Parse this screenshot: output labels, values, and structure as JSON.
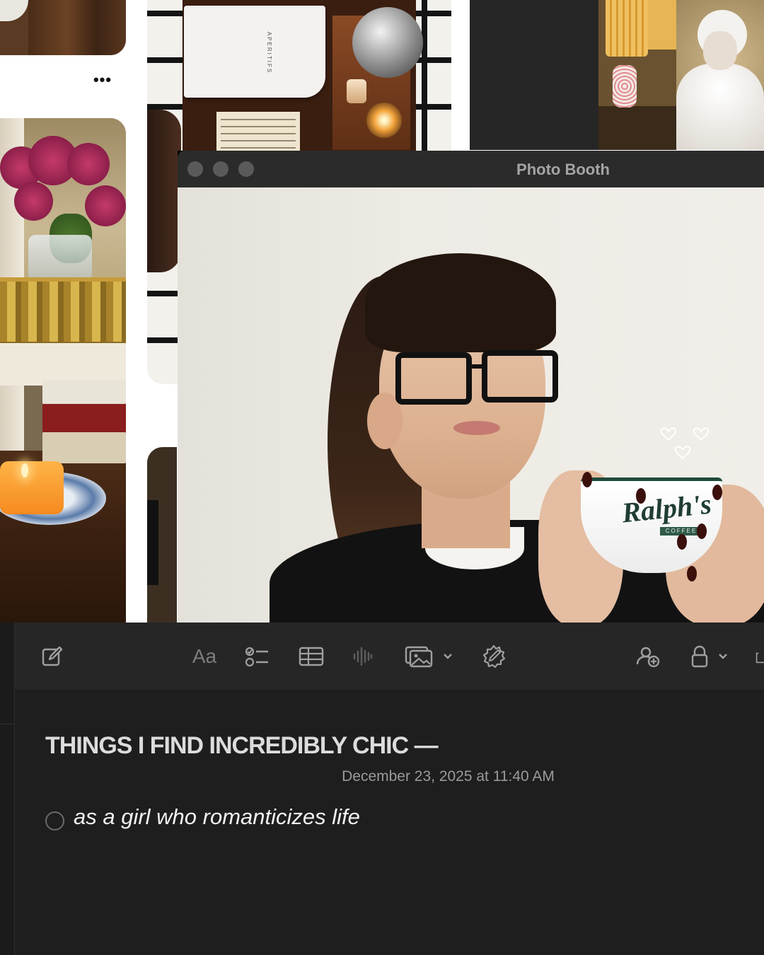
{
  "collage": {
    "more_menu_label": "•••",
    "aperitifs_book_label": "APERITIFS"
  },
  "photo_booth": {
    "window_title": "Photo Booth",
    "cup_brand": "Ralph's",
    "cup_band": "COFFEE"
  },
  "notes": {
    "toolbar": {
      "icons": [
        "compose-icon",
        "format-text-icon",
        "checklist-icon",
        "table-icon",
        "audio-waveform-icon",
        "media-icon",
        "chevron-down-icon",
        "writing-tools-icon",
        "collaborate-icon",
        "lock-icon",
        "chevron-down-icon",
        "share-icon"
      ],
      "format_label": "Aa"
    },
    "date": "December 23, 2025 at 11:40 AM",
    "title": "THINGS I FIND INCREDIBLY CHIC —",
    "checklist": [
      {
        "text": "as a girl who romanticizes life",
        "checked": false
      }
    ]
  },
  "colors": {
    "notes_background": "#1e1e1e",
    "toolbar_background": "#262626",
    "titlebar_background": "#2b2b2b",
    "traffic_light_inactive": "#5a5a5a"
  }
}
